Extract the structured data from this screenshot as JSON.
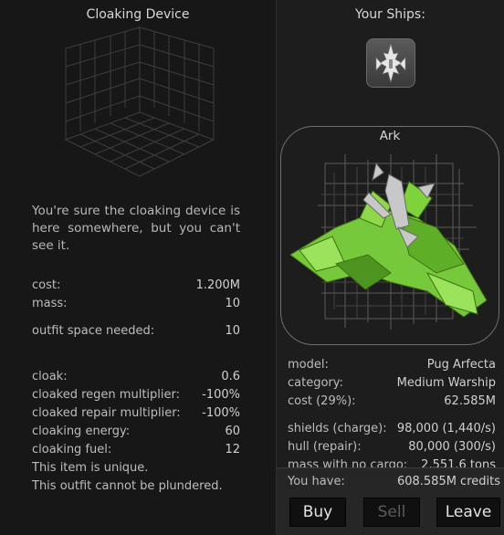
{
  "outfit": {
    "title": "Cloaking Device",
    "description": "You're sure the cloaking device is here somewhere, but you can't see it.",
    "cost_label": "cost:",
    "cost_value": "1.200M",
    "mass_label": "mass:",
    "mass_value": "10",
    "space_label": "outfit space needed:",
    "space_value": "10",
    "attributes": [
      {
        "label": "cloak:",
        "value": "0.6"
      },
      {
        "label": "cloaked regen multiplier:",
        "value": "-100%"
      },
      {
        "label": "cloaked repair multiplier:",
        "value": "-100%"
      },
      {
        "label": "cloaking energy:",
        "value": "60"
      },
      {
        "label": "cloaking fuel:",
        "value": "12"
      }
    ],
    "notes": [
      "This item is unique.",
      "This outfit cannot be plundered."
    ]
  },
  "ships": {
    "title": "Your Ships:",
    "thumbnail_icon": "ship-thumbnail-icon",
    "selected": {
      "name": "Ark",
      "image_icon": "ark-ship-icon",
      "stats": [
        {
          "label": "model:",
          "value": "Pug Arfecta"
        },
        {
          "label": "category:",
          "value": "Medium Warship"
        },
        {
          "label": "cost (29%):",
          "value": "62.585M"
        },
        {
          "label": "shields (charge):",
          "value": "98,000 (1,440/s)"
        },
        {
          "label": "hull (repair):",
          "value": "80,000 (300/s)"
        },
        {
          "label": "mass with no cargo:",
          "value": "2,551.6 tons"
        }
      ]
    }
  },
  "footer": {
    "you_have_label": "You have:",
    "credits": "608.585M credits",
    "buy_label": "Buy",
    "sell_label": "Sell",
    "leave_label": "Leave"
  },
  "colors": {
    "ship_green": "#7ed23a",
    "ship_silver": "#bfbfbf",
    "panel_bg": "#171717",
    "button_bg": "#101010"
  }
}
